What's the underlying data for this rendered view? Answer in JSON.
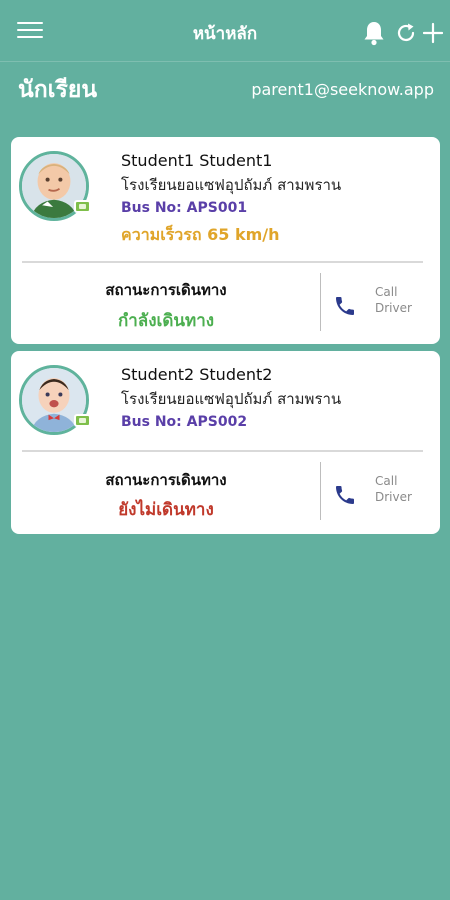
{
  "header": {
    "title": "หน้าหลัก",
    "section_title": "นักเรียน",
    "user_email": "parent1@seeknow.app"
  },
  "colors": {
    "background": "#62b09f",
    "bus_no": "#5a3fa8",
    "speed": "#e0a52a",
    "status_moving": "#4caf50",
    "status_not_moving": "#c0392b",
    "phone_icon": "#2b3a8c"
  },
  "icons": {
    "menu": "menu-icon",
    "notifications": "bell-icon",
    "refresh": "refresh-icon",
    "add": "plus-icon",
    "call": "phone-icon"
  },
  "students": [
    {
      "name": "Student1 Student1",
      "school": "โรงเรียนยอแซฟอุปถัมภ์ สามพราน",
      "bus_no": "Bus No: APS001",
      "speed": "ความเร็วรถ 65 km/h",
      "status_label": "สถานะการเดินทาง",
      "status_value": "กำลังเดินทาง",
      "call_label_1": "Call",
      "call_label_2": "Driver"
    },
    {
      "name": "Student2 Student2",
      "school": "โรงเรียนยอแซฟอุปถัมภ์ สามพราน",
      "bus_no": "Bus No: APS002",
      "status_label": "สถานะการเดินทาง",
      "status_value": "ยังไม่เดินทาง",
      "call_label_1": "Call",
      "call_label_2": "Driver"
    }
  ]
}
